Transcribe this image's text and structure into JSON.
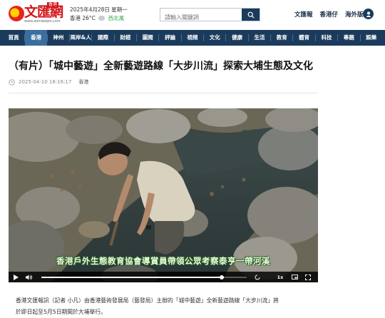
{
  "header": {
    "logo_text": "文匯網",
    "logo_badge": "香港",
    "logo_url": "www.wenweipo.com",
    "date": "2025年4月28日 星期一",
    "weather_location": "香港",
    "temperature": "26°C",
    "aqi_label": "西北風",
    "search_placeholder": "請輸入關鍵詞",
    "links": [
      "文匯報",
      "香港仔",
      "海外版"
    ]
  },
  "nav": {
    "items": [
      "首頁",
      "香港",
      "神州",
      "兩岸&人",
      "國際",
      "財經",
      "圖閱",
      "評論",
      "視頻",
      "文化",
      "健康",
      "生活",
      "教育",
      "體育",
      "科技",
      "專題",
      "娛樂"
    ],
    "active_index": 1
  },
  "article": {
    "title": "（有片）「城中藝遊」全新藝遊路線「大步川流」探索大埔生態及文化",
    "timestamp": "2025-04-10 18:16:17",
    "location": "香港",
    "video": {
      "subtitle": "香港戶外生態教育協會導賞員帶領公眾考察泰亨一帶河溪",
      "progress": 0.88,
      "speed": "1x"
    },
    "body_line1": "香港文匯報訊（記者 小凡）由香港藝術發展局（藝發局）主辦的「城中藝遊」全新藝遊路線「大步川流」將",
    "body_line2": "於即日起至5月5日期間於大埔舉行。"
  }
}
